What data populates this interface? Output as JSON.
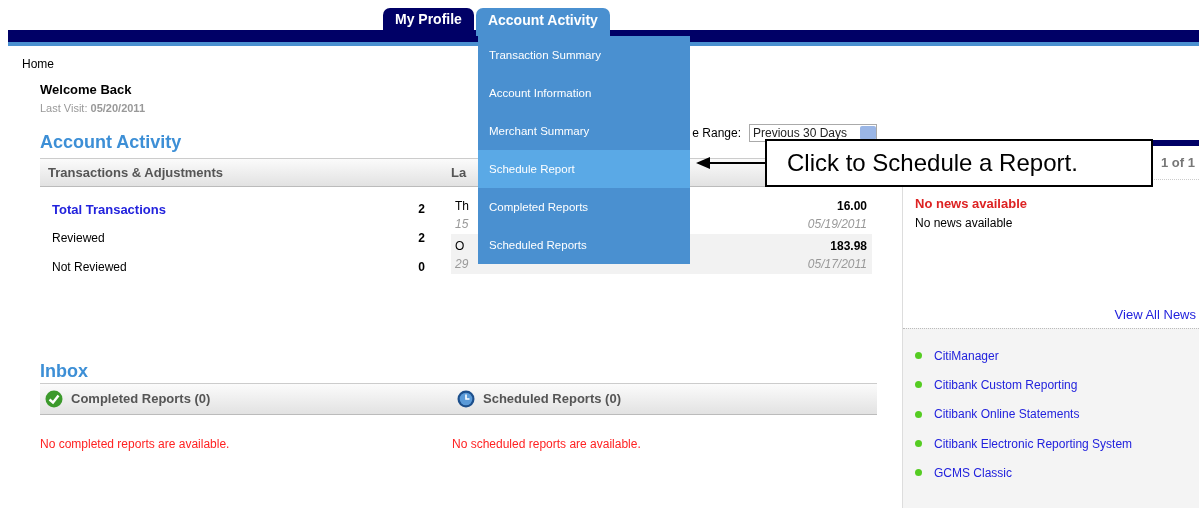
{
  "tabs": [
    {
      "label": "My Profile",
      "selected": false
    },
    {
      "label": "Account Activity",
      "selected": true
    }
  ],
  "menu": [
    {
      "label": "Transaction Summary",
      "highlighted": false
    },
    {
      "label": "Account Information",
      "highlighted": false
    },
    {
      "label": "Merchant Summary",
      "highlighted": false
    },
    {
      "label": "Schedule Report",
      "highlighted": true
    },
    {
      "label": "Completed Reports",
      "highlighted": false
    },
    {
      "label": "Scheduled Reports",
      "highlighted": false
    }
  ],
  "breadcrumb": "Home",
  "welcome": {
    "title": "Welcome Back",
    "last_visit_label": "Last Visit:",
    "last_visit_date": "05/20/2011"
  },
  "account_activity": {
    "title": "Account Activity",
    "date_range_label": "e Range:",
    "date_range_value": "Previous 30 Days",
    "columns": [
      "Transactions & Adjustments",
      "La"
    ],
    "summary": [
      {
        "label": "Total Transactions",
        "count": "2",
        "kind": "link"
      },
      {
        "label": "Reviewed",
        "count": "2",
        "kind": "text"
      },
      {
        "label": "Not Reviewed",
        "count": "0",
        "kind": "text"
      }
    ],
    "transactions": [
      {
        "name": "Th",
        "ref": "15",
        "amount": "16.00",
        "date": "05/19/2011"
      },
      {
        "name": "O",
        "ref": "29",
        "amount": "183.98",
        "date": "05/17/2011"
      }
    ]
  },
  "inbox": {
    "title": "Inbox",
    "sections": [
      {
        "kind": "completed",
        "title": "Completed Reports (0)",
        "message": "No completed reports are available."
      },
      {
        "kind": "scheduled",
        "title": "Scheduled Reports (0)",
        "message": "No scheduled reports are available."
      }
    ]
  },
  "news": {
    "pager": "1 of 1",
    "headline": "No news available",
    "text": "No news available",
    "view_all": "View All News"
  },
  "links": [
    "CitiManager",
    "Citibank Custom Reporting",
    "Citibank Online Statements",
    "Citibank Electronic Reporting System",
    "GCMS Classic"
  ],
  "callout": "Click to Schedule a Report."
}
